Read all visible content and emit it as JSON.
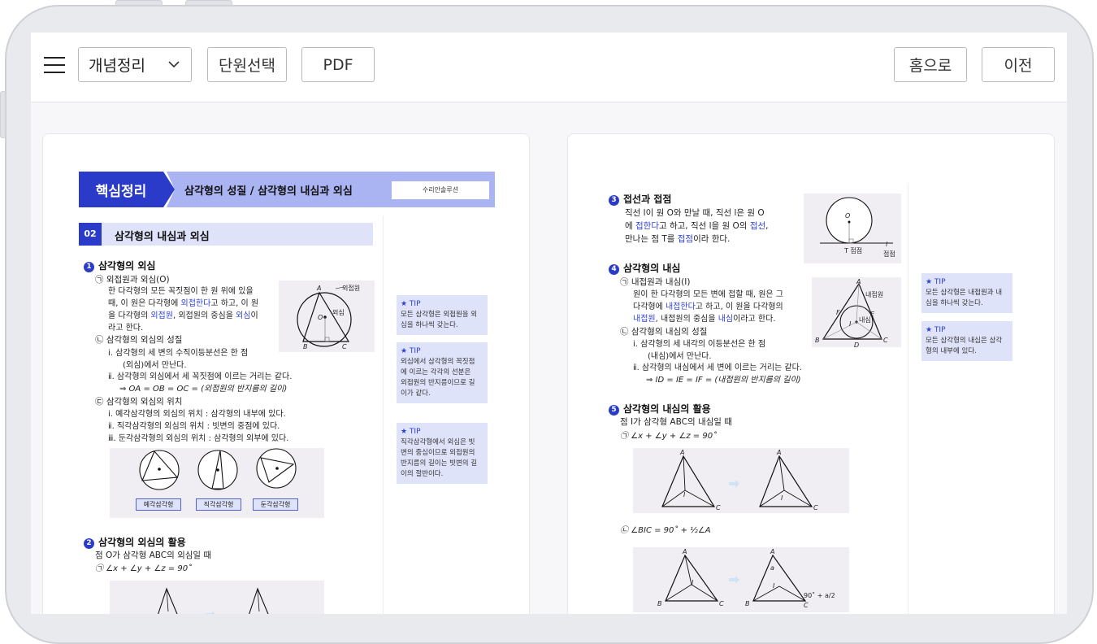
{
  "toolbar": {
    "select_value": "개념정리",
    "unit_select_label": "단원선택",
    "pdf_label": "PDF",
    "home_label": "홈으로",
    "prev_label": "이전"
  },
  "left_page": {
    "banner_label": "핵심정리",
    "banner_title": "삼각형의 성질 / 삼각형의 내심과 외심",
    "banner_tag": "수리안솔루션",
    "chapter_number": "02",
    "chapter_title": "삼각형의 내심과 외심",
    "sec1": {
      "number": "1",
      "title": "삼각형의 외심",
      "a_title": "㉠ 외접원과 외심(O)",
      "a_line1": "한 다각형의 모든 꼭짓점이 한 원 위에 있을",
      "a_line2_pre": "때, 이 원은 다각형에 ",
      "a_line2_blue": "외접한다",
      "a_line2_post": "고 하고, 이 원",
      "a_line3_pre": "을 다각형의 ",
      "a_line3_blue1": "외접원",
      "a_line3_mid": ", 외접원의 중심을 ",
      "a_line3_blue2": "외심",
      "a_line3_post": "이",
      "a_line4": "라고 한다.",
      "b_title": "㉡ 삼각형의 외심의 성질",
      "b_i1": "ⅰ. 삼각형의 세 변의 수직이등분선은 한 점",
      "b_i1b": "(외심)에서 만난다.",
      "b_i2": "ⅱ. 삼각형의 외심에서 세 꼭짓점에 이르는 거리는 같다.",
      "b_i3": "⇒ OA = OB = OC = (외접원의 반지름의 길이)",
      "c_title": "㉢ 삼각형의 외심의 위치",
      "c_i1": "ⅰ. 예각삼각형의 외심의 위치 : 삼각형의 내부에 있다.",
      "c_i2": "ⅱ. 직각삼각형의 외심의 위치 : 빗변의 중점에 있다.",
      "c_i3": "ⅲ. 둔각삼각형의 외심의 위치 : 삼각형의 외부에 있다.",
      "fig_label_circle": "외접원",
      "fig_label_center": "외심",
      "fig_A": "A",
      "fig_B": "B",
      "fig_C": "C",
      "fig_O": "O",
      "captions": [
        "예각삼각형",
        "직각삼각형",
        "둔각삼각형"
      ]
    },
    "sec2": {
      "number": "2",
      "title": "삼각형의 외심의 활용",
      "line1": "점 O가 삼각형 ABC의 외심일 때",
      "line2": "㉠ ∠x + ∠y + ∠z = 90˚"
    },
    "tips": [
      {
        "head": "★ TIP",
        "body": [
          "모든 삼각형은 외접원을 외",
          "심을 하나씩 갖는다."
        ]
      },
      {
        "head": "★ TIP",
        "body": [
          "외심에서 삼각형의 꼭짓점",
          "에 이르는 각각의 선분은",
          "외접원의 반지름이므로 길",
          "이가 같다."
        ]
      },
      {
        "head": "★ TIP",
        "body": [
          "직각삼각형에서 외심은 빗",
          "변의 중심이므로 외접원의",
          "반지름의 길이는 빗변의 길",
          "이의 절반이다."
        ]
      }
    ]
  },
  "right_page": {
    "sec3": {
      "number": "3",
      "title": "접선과 접점",
      "line1": "직선 l이 원 O와 만날 때, 직선 l은 원 O",
      "line2_pre": "에 ",
      "line2_blue1": "접한다",
      "line2_mid": "고 하고, 직선 l을 원 O의 ",
      "line2_blue2": "접선",
      "line2_post": ",",
      "line3_pre": "만나는 점 T를 ",
      "line3_blue": "접점",
      "line3_post": "이라 한다.",
      "fig_O": "O",
      "fig_T": "T 접점",
      "fig_l": "l",
      "fig_l_label": "접점"
    },
    "sec4": {
      "number": "4",
      "title": "삼각형의 내심",
      "a_title": "㉠ 내접원과 내심(I)",
      "a_line1": "원이 한 다각형의 모든 변에 접할 때, 원은 그",
      "a_line2_pre": "다각형에 ",
      "a_line2_blue": "내접한다",
      "a_line2_post": "고 하고, 이 원을 다각형의",
      "a_line3_blue1": "내접원",
      "a_line3_mid": ", 내접원의 중심을 ",
      "a_line3_blue2": "내심",
      "a_line3_post": "이라고 한다.",
      "b_title": "㉡ 삼각형의 내심의 성질",
      "b_i1": "ⅰ. 삼각형의 세 내각의 이등분선은 한 점",
      "b_i1b": "(내심)에서 만난다.",
      "b_i2": "ⅱ. 삼각형의 내심에서 세 변에 이르는 거리는 같다.",
      "b_i3": "⇒ ID = IE = IF = (내접원의 반지름의 길이)",
      "fig_label_circle": "내접원",
      "fig_label_center": "내심",
      "fig_A": "A",
      "fig_B": "B",
      "fig_C": "C",
      "fig_D": "D",
      "fig_E": "E",
      "fig_F": "F",
      "fig_I": "I"
    },
    "sec5": {
      "number": "5",
      "title": "삼각형의 내심의 활용",
      "line1": "점 I가 삼각형 ABC의 내심일 때",
      "line2": "㉠ ∠x + ∠y + ∠z = 90˚",
      "line3": "㉡ ∠BIC = 90˚ + ½∠A",
      "fig_A": "A",
      "fig_B": "B",
      "fig_C": "C",
      "fig_I": "I",
      "fig_a": "a",
      "fig_expr": "90˚ + a/2"
    },
    "tips": [
      {
        "head": "★ TIP",
        "body": [
          "모든 삼각형은 내접원과 내",
          "심을 하나씩 갖는다."
        ]
      },
      {
        "head": "★ TIP",
        "body": [
          "모든 삼각형의 내심은 삼각",
          "형의 내부에 있다."
        ]
      }
    ]
  }
}
